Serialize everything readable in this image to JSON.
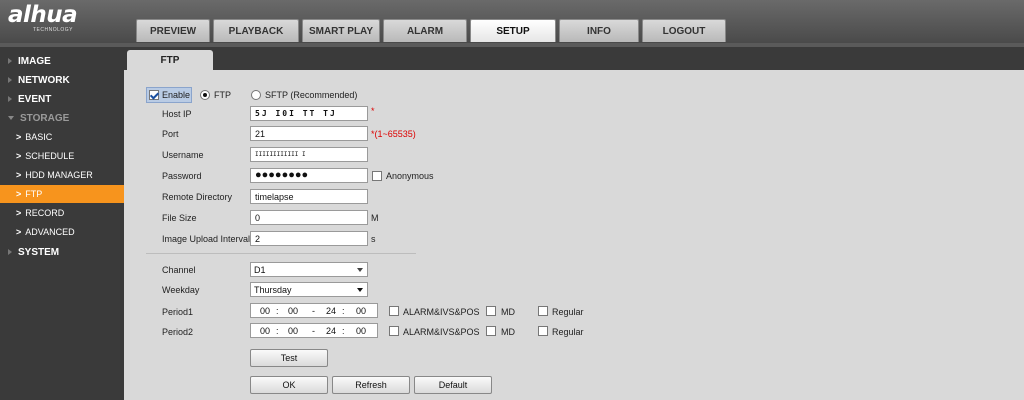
{
  "brand": {
    "logo": "alhua",
    "subtitle": "TECHNOLOGY"
  },
  "tabs": [
    {
      "label": "PREVIEW"
    },
    {
      "label": "PLAYBACK"
    },
    {
      "label": "SMART PLAY"
    },
    {
      "label": "ALARM"
    },
    {
      "label": "SETUP",
      "active": true
    },
    {
      "label": "INFO"
    },
    {
      "label": "LOGOUT"
    }
  ],
  "sidebar": {
    "items": [
      {
        "label": "IMAGE"
      },
      {
        "label": "NETWORK"
      },
      {
        "label": "EVENT"
      },
      {
        "label": "STORAGE"
      },
      {
        "label": "SYSTEM"
      }
    ],
    "storage_subitems": [
      {
        "label": "BASIC"
      },
      {
        "label": "SCHEDULE"
      },
      {
        "label": "HDD MANAGER"
      },
      {
        "label": "FTP",
        "active": true
      },
      {
        "label": "RECORD"
      },
      {
        "label": "ADVANCED"
      }
    ],
    "chevron": ">"
  },
  "page": {
    "tab_label": "FTP"
  },
  "form": {
    "enable_label": "Enable",
    "enable_checked": true,
    "protocol_ftp": "FTP",
    "protocol_sftp": "SFTP (Recommended)",
    "selected_protocol": "FTP",
    "required_mark": "*",
    "host_ip_label": "Host IP",
    "host_ip_value": "5J   I0I   TT   TJ",
    "port_label": "Port",
    "port_value": "21",
    "port_hint": "*(1~65535)",
    "username_label": "Username",
    "username_value": "IIIIIIIIIIII I",
    "password_label": "Password",
    "password_value": "●●●●●●●●",
    "anonymous_label": "Anonymous",
    "anonymous_checked": false,
    "remote_dir_label": "Remote Directory",
    "remote_dir_value": "timelapse",
    "file_size_label": "File Size",
    "file_size_value": "0",
    "file_size_unit": "M",
    "upload_interval_label": "Image Upload Interval",
    "upload_interval_value": "2",
    "upload_interval_unit": "s",
    "channel_label": "Channel",
    "channel_value": "D1",
    "weekday_label": "Weekday",
    "weekday_value": "Thursday",
    "periods": [
      {
        "label": "Period1",
        "start_h": "00",
        "start_m": "00",
        "end_h": "24",
        "end_m": "00",
        "dash": "-",
        "colon": ":",
        "alarm_label": "ALARM&IVS&POS",
        "md_label": "MD",
        "regular_label": "Regular"
      },
      {
        "label": "Period2",
        "start_h": "00",
        "start_m": "00",
        "end_h": "24",
        "end_m": "00",
        "dash": "-",
        "colon": ":",
        "alarm_label": "ALARM&IVS&POS",
        "md_label": "MD",
        "regular_label": "Regular"
      }
    ]
  },
  "buttons": {
    "test": "Test",
    "ok": "OK",
    "refresh": "Refresh",
    "default": "Default"
  },
  "colors": {
    "active_sidebar": "#f7941d",
    "panel_bg": "#d9d9d9",
    "sidebar_bg": "#3a3a3a",
    "required": "#dd0000"
  }
}
